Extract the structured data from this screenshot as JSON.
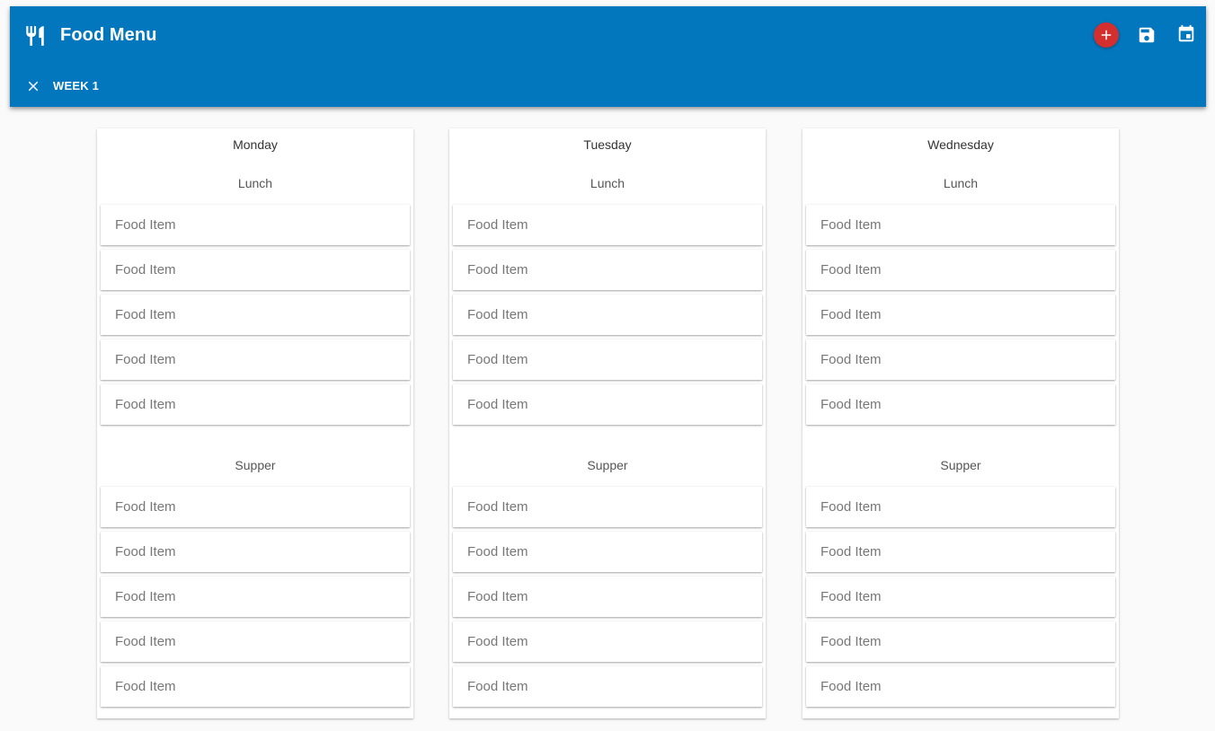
{
  "app": {
    "title": "Food Menu",
    "accent_color": "#0277bd",
    "add_color": "#d32f2f",
    "icons": {
      "app": "silverware-icon",
      "add": "plus-icon",
      "save": "save-icon",
      "calendar": "calendar-icon",
      "close": "close-icon"
    }
  },
  "week": {
    "label": "WEEK 1"
  },
  "days": [
    {
      "name": "Monday",
      "lunch": {
        "label": "Lunch",
        "items": [
          "Food Item",
          "Food Item",
          "Food Item",
          "Food Item",
          "Food Item"
        ]
      },
      "supper": {
        "label": "Supper",
        "items": [
          "Food Item",
          "Food Item",
          "Food Item",
          "Food Item",
          "Food Item"
        ]
      }
    },
    {
      "name": "Tuesday",
      "lunch": {
        "label": "Lunch",
        "items": [
          "Food Item",
          "Food Item",
          "Food Item",
          "Food Item",
          "Food Item"
        ]
      },
      "supper": {
        "label": "Supper",
        "items": [
          "Food Item",
          "Food Item",
          "Food Item",
          "Food Item",
          "Food Item"
        ]
      }
    },
    {
      "name": "Wednesday",
      "lunch": {
        "label": "Lunch",
        "items": [
          "Food Item",
          "Food Item",
          "Food Item",
          "Food Item",
          "Food Item"
        ]
      },
      "supper": {
        "label": "Supper",
        "items": [
          "Food Item",
          "Food Item",
          "Food Item",
          "Food Item",
          "Food Item"
        ]
      }
    }
  ]
}
